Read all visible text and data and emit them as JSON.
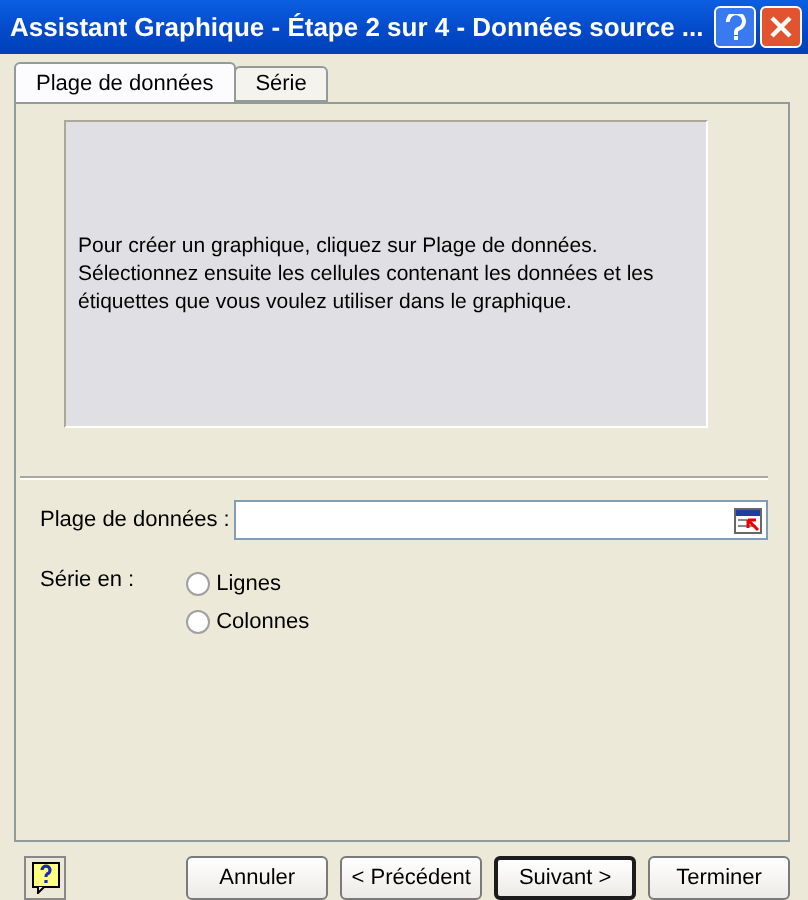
{
  "window": {
    "title": "Assistant Graphique - Étape 2 sur 4 - Données source ..."
  },
  "tabs": [
    {
      "label": "Plage de données",
      "selected": true
    },
    {
      "label": "Série",
      "selected": false
    }
  ],
  "preview": {
    "message": "Pour créer un graphique, cliquez sur Plage de données. Sélectionnez ensuite les cellules contenant les données et les étiquettes que vous voulez utiliser dans le graphique."
  },
  "range": {
    "label": "Plage de données :"
  },
  "series_in": {
    "label": "Série en :",
    "options": [
      {
        "label": "Lignes",
        "selected": false
      },
      {
        "label": "Colonnes",
        "selected": false
      }
    ]
  },
  "buttons": [
    {
      "label": "Annuler",
      "default": false
    },
    {
      "label": "< Précédent",
      "default": false
    },
    {
      "label": "Suivant >",
      "default": true
    },
    {
      "label": "Terminer",
      "default": false
    }
  ]
}
